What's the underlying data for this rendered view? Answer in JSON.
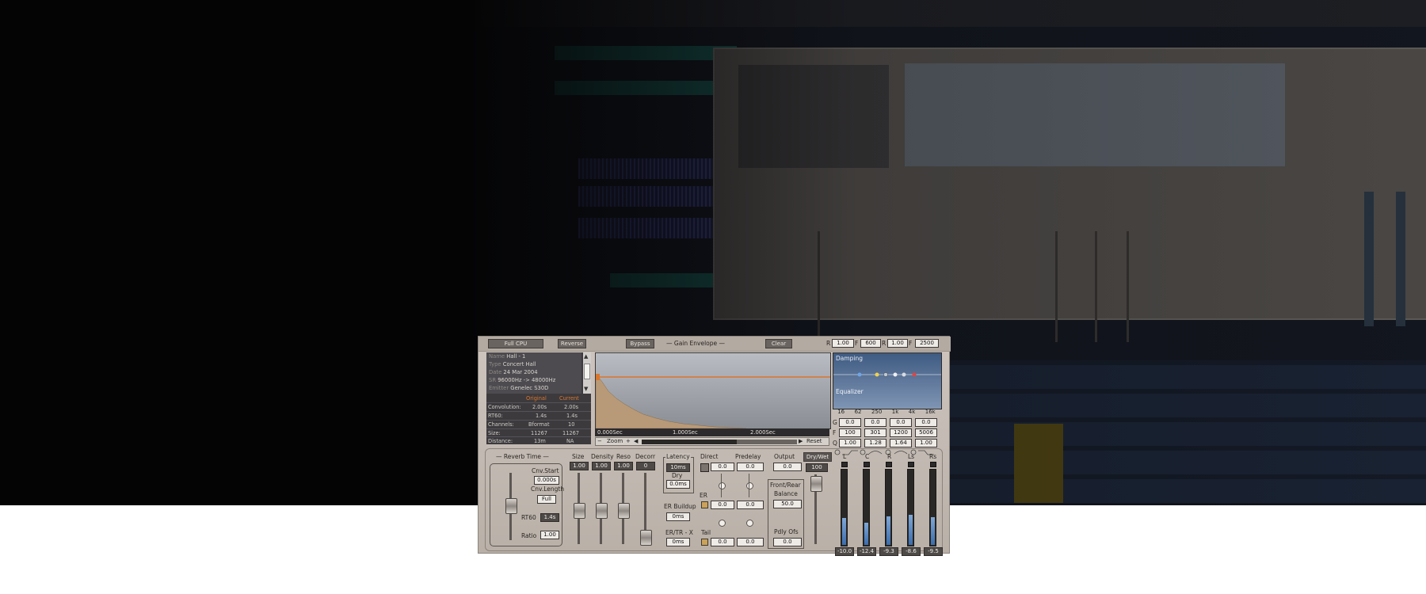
{
  "plugin": {
    "top": {
      "full_cpu": "Full CPU",
      "reverse": "Reverse",
      "bypass": "Bypass",
      "gain_envelope": "Gain Envelope",
      "clear": "Clear",
      "r1_label": "R",
      "r1_value": "1.00",
      "f1_label": "F",
      "f1_value": "600",
      "r2_label": "R",
      "r2_value": "1.00",
      "f2_label": "F",
      "f2_value": "2500"
    },
    "info": {
      "name_label": "Name",
      "name": "Hall - 1",
      "type_label": "Type",
      "type": "Concert Hall",
      "date_label": "Date",
      "date": "24 Mar 2004",
      "sr_label": "SR",
      "sr": "96000Hz -> 48000Hz",
      "emitter_label": "Emitter",
      "emitter": "Genelec S30D",
      "col_original": "Original",
      "col_current": "Current",
      "rows": [
        {
          "label": "Convolution:",
          "original": "2.00s",
          "current": "2.00s"
        },
        {
          "label": "RT60:",
          "original": "1.4s",
          "current": "1.4s"
        },
        {
          "label": "Channels:",
          "original": "Bformat",
          "current": "10"
        },
        {
          "label": "Size:",
          "original": "11267",
          "current": "11267"
        },
        {
          "label": "Distance:",
          "original": "13m",
          "current": "NA"
        }
      ]
    },
    "graph": {
      "t0": "0.000Sec",
      "t1": "1.000Sec",
      "t2": "2.000Sec",
      "zoom": "Zoom",
      "reset": "Reset"
    },
    "eq": {
      "damping": "Damping",
      "equalizer": "Equalizer",
      "freqs": [
        "16",
        "62",
        "250",
        "1k",
        "4k",
        "16k"
      ],
      "g_label": "G",
      "g_values": [
        "0.0",
        "0.0",
        "0.0",
        "0.0"
      ],
      "f_label": "F",
      "f_values": [
        "100",
        "301",
        "1200",
        "5006"
      ],
      "q_label": "Q",
      "q_values": [
        "1.00",
        "1.28",
        "1.64",
        "1.00"
      ]
    },
    "reverb": {
      "title": "Reverb Time",
      "cnv_start": "Cnv.Start",
      "cnv_start_value": "0.000s",
      "cnv_length": "Cnv.Length",
      "cnv_length_value": "Full",
      "rt60": "RT60",
      "rt60_value": "1.4s",
      "ratio": "Ratio",
      "ratio_value": "1.00"
    },
    "params": {
      "size": "Size",
      "size_value": "1.00",
      "density": "Density",
      "density_value": "1.00",
      "reso": "Reso",
      "reso_value": "1.00",
      "decorr": "Decorr",
      "decorr_value": "0",
      "latency": "Latency",
      "latency_value": "10ms",
      "dry": "Dry",
      "dry_value": "0.0ms",
      "er_buildup": "ER Buildup",
      "er_buildup_value": "0ms",
      "er_tr_x": "ER/TR - X",
      "er_tr_x_value": "0ms",
      "direct": "Direct",
      "direct_value": "0.0",
      "predelay": "Predelay",
      "predelay_value": "0.0",
      "er": "ER",
      "er_value1": "0.0",
      "er_value2": "0.0",
      "tail": "Tail",
      "tail_value1": "0.0",
      "tail_value2": "0.0",
      "output": "Output",
      "output_value": "0.0",
      "front_rear": "Front/Rear",
      "balance": "Balance",
      "balance_value": "50.0",
      "pdly_ofs": "Pdly Ofs",
      "pdly_ofs_value": "0.0",
      "dry_wet": "Dry/Wet",
      "dry_wet_value": "100"
    },
    "meters": [
      {
        "label": "L",
        "value": "-10.0",
        "level": 0.36
      },
      {
        "label": "C",
        "value": "-12.4",
        "level": 0.3
      },
      {
        "label": "R",
        "value": "-9.3",
        "level": 0.38
      },
      {
        "label": "Ls",
        "value": "-8.6",
        "level": 0.4
      },
      {
        "label": "Rs",
        "value": "-9.5",
        "level": 0.37
      }
    ]
  },
  "colors": {
    "accent_orange": "#d9762d",
    "meter_blue": "#5c8cc6",
    "eq_blue": "#4e6b92"
  }
}
